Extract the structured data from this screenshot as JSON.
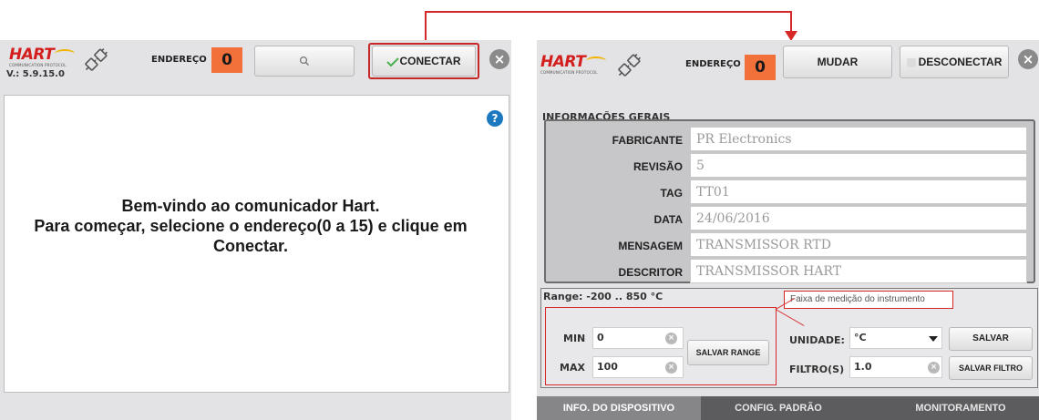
{
  "left_panel": {
    "logo_text": "HART",
    "logo_sub": "COMMUNICATION PROTOCOL",
    "version": "V.: 5.9.15.0",
    "address_label": "ENDEREÇO",
    "address_value": "0",
    "search_icon": "search-icon",
    "connect_label": "CONECTAR",
    "welcome_line1": "Bem-vindo ao comunicador Hart.",
    "welcome_line2": "Para começar, selecione o endereço(0 a 15) e clique em",
    "welcome_line3": "Conectar.",
    "help_symbol": "?"
  },
  "right_panel": {
    "logo_text": "HART",
    "logo_sub": "COMMUNICATION PROTOCOL",
    "address_label": "ENDEREÇO",
    "address_value": "0",
    "change_label": "MUDAR",
    "disconnect_label": "DESCONECTAR",
    "section_title": "INFORMAÇÕES GERAIS",
    "info_rows": [
      {
        "label": "FABRICANTE",
        "value": "PR Electronics"
      },
      {
        "label": "REVISÃO",
        "value": "5"
      },
      {
        "label": "TAG",
        "value": "TT01"
      },
      {
        "label": "DATA",
        "value": "24/06/2016"
      },
      {
        "label": "MENSAGEM",
        "value": "TRANSMISSOR RTD"
      },
      {
        "label": "DESCRITOR",
        "value": "TRANSMISSOR HART"
      }
    ],
    "range_label": "Range: -200 .. 850 °C",
    "callout_text": "Faixa de medição do instrumento",
    "min_label": "MIN",
    "min_value": "0",
    "max_label": "MAX",
    "max_value": "100",
    "save_range_label": "SALVAR RANGE",
    "unit_label": "UNIDADE:",
    "unit_value": "°C",
    "save_label": "SALVAR",
    "filter_label": "FILTRO(S)",
    "filter_value": "1.0",
    "save_filter_label": "SALVAR FILTRO",
    "tabs": [
      {
        "label": "INFO. DO DISPOSITIVO"
      },
      {
        "label": "CONFIG. PADRÃO"
      },
      {
        "label": "MONITORAMENTO"
      }
    ]
  },
  "colors": {
    "accent_red": "#d62828",
    "address_orange": "#f2703a",
    "help_blue": "#1c79c0"
  }
}
